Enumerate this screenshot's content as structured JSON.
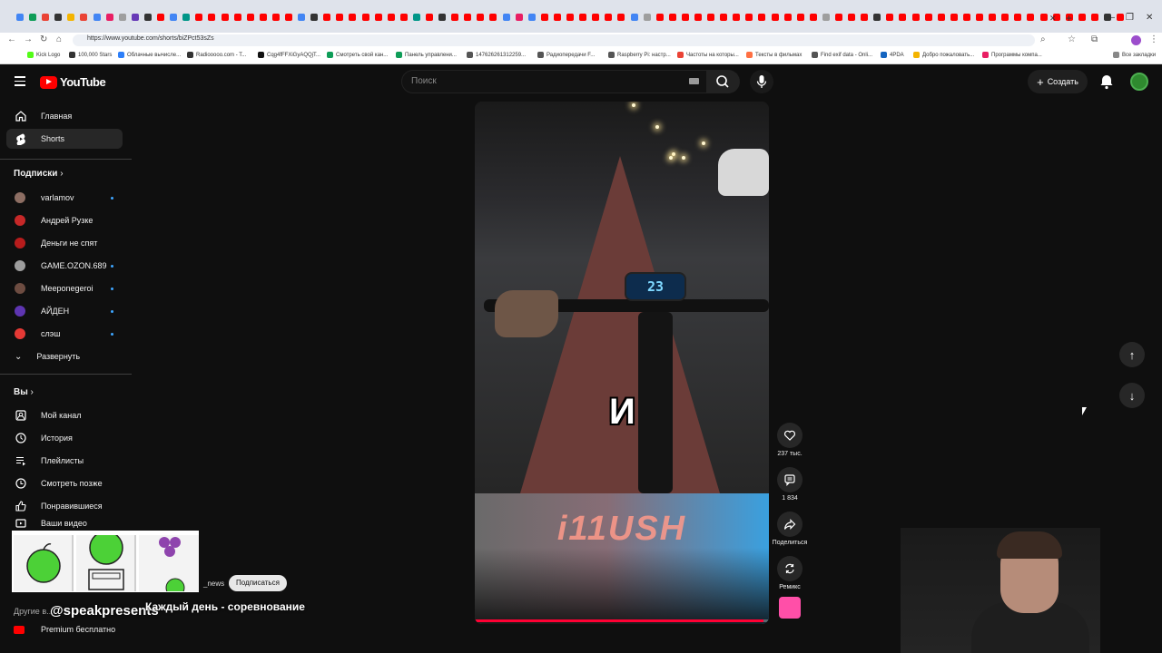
{
  "browser": {
    "tab_favicon_colors": [
      "#4285f4",
      "#0f9d58",
      "#ea4335",
      "#333333",
      "#f4b400",
      "#ea4335",
      "#4285f4",
      "#e91e63",
      "#9e9e9e",
      "#673ab7",
      "#333333",
      "#ff0000",
      "#4285f4",
      "#009688",
      "#ff0000",
      "#ff0000",
      "#ff0000",
      "#ff0000",
      "#ff0000",
      "#ff0000",
      "#ff0000",
      "#ff0000",
      "#4285f4",
      "#333333",
      "#ff0000",
      "#ff0000",
      "#ff0000",
      "#ff0000",
      "#ff0000",
      "#ff0000",
      "#ff0000",
      "#009688",
      "#ff0000",
      "#333333",
      "#ff0000",
      "#ff0000",
      "#ff0000",
      "#ff0000",
      "#4285f4",
      "#e91e63",
      "#4285f4",
      "#ff0000",
      "#ff0000",
      "#ff0000",
      "#ff0000",
      "#ff0000",
      "#ff0000",
      "#ff0000",
      "#4285f4",
      "#9e9e9e",
      "#ff0000",
      "#ff0000",
      "#ff0000",
      "#ff0000",
      "#ff0000",
      "#ff0000",
      "#ff0000",
      "#ff0000",
      "#ff0000",
      "#ff0000",
      "#ff0000",
      "#ff0000",
      "#ff0000",
      "#9e9e9e",
      "#ff0000",
      "#ff0000",
      "#ff0000",
      "#333333",
      "#ff0000",
      "#ff0000",
      "#ff0000",
      "#ff0000",
      "#ff0000",
      "#ff0000",
      "#ff0000",
      "#ff0000",
      "#ff0000",
      "#ff0000",
      "#ff0000",
      "#ff0000",
      "#ff0000",
      "#ff0000",
      "#ff0000",
      "#ff0000",
      "#ff0000",
      "#333333",
      "#ff0000"
    ],
    "url": "https://www.youtube.com/shorts/biZPct53sZs",
    "bookmarks": [
      {
        "label": "Kick Logo",
        "color": "#53fc18"
      },
      {
        "label": "100,000 Stars",
        "color": "#333333"
      },
      {
        "label": "Облачные вычисле...",
        "color": "#2d7ff9"
      },
      {
        "label": "Radiooooo.com - T...",
        "color": "#333333"
      },
      {
        "label": "Cqg4fFFXiGyAQQjT...",
        "color": "#111111"
      },
      {
        "label": "Смотреть свой кан...",
        "color": "#0f9d58"
      },
      {
        "label": "Панель управлени...",
        "color": "#0f9d58"
      },
      {
        "label": "147626261312259...",
        "color": "#555555"
      },
      {
        "label": "Радиопередачи F...",
        "color": "#555555"
      },
      {
        "label": "Raspberry Pi: настр...",
        "color": "#555555"
      },
      {
        "label": "Частоты на которы...",
        "color": "#ea4335"
      },
      {
        "label": "Тексты в фильмах",
        "color": "#ff7043"
      },
      {
        "label": "Find exif data - Onli...",
        "color": "#555555"
      },
      {
        "label": "4PDA",
        "color": "#1565c0"
      },
      {
        "label": "Добро пожаловать...",
        "color": "#f4b400"
      },
      {
        "label": "Программы компа...",
        "color": "#e91e63"
      }
    ],
    "all_bookmarks_label": "Все закладки"
  },
  "youtube": {
    "logo_text": "YouTube",
    "search_placeholder": "Поиск",
    "create_label": "Создать",
    "sidebar": {
      "main": [
        {
          "label": "Главная",
          "icon": "home-icon"
        },
        {
          "label": "Shorts",
          "icon": "shorts-icon",
          "active": true
        }
      ],
      "subscriptions_header": "Подписки",
      "subscriptions": [
        {
          "label": "varlamov",
          "color": "#8d6e63",
          "new": true
        },
        {
          "label": "Андрей Рузке",
          "color": "#c62828",
          "new": false
        },
        {
          "label": "Деньги не спят",
          "color": "#b71c1c",
          "new": false
        },
        {
          "label": "GAME.OZON.689",
          "color": "#9e9e9e",
          "new": true
        },
        {
          "label": "Meeponegeroi",
          "color": "#6d4c41",
          "new": true
        },
        {
          "label": "АЙДЕН",
          "color": "#5e35b1",
          "new": true
        },
        {
          "label": "слэш",
          "color": "#e53935",
          "new": true
        }
      ],
      "expand_label": "Развернуть",
      "you_header": "Вы",
      "you": [
        {
          "label": "Мой канал",
          "icon": "channel-icon"
        },
        {
          "label": "История",
          "icon": "history-icon"
        },
        {
          "label": "Плейлисты",
          "icon": "playlist-icon"
        },
        {
          "label": "Смотреть позже",
          "icon": "clock-icon"
        },
        {
          "label": "Понравившиеся",
          "icon": "thumbs-up-icon"
        },
        {
          "label": "Ваши видео",
          "icon": "video-icon"
        }
      ],
      "other_label": "Другие в...",
      "premium_label": "Premium бесплатно"
    },
    "short": {
      "speed_display": "23",
      "caption_letter": "И",
      "brand_text": "i11USH",
      "progress": 0.98,
      "likes": "237 тыс.",
      "comments": "1 834",
      "share_label": "Поделиться",
      "remix_label": "Ремикс"
    }
  },
  "stream_overlay": {
    "news_label": "_news",
    "subscribe_label": "Подписаться",
    "handle": "@speakpresents",
    "tagline": "Каждый день - соревнование"
  }
}
